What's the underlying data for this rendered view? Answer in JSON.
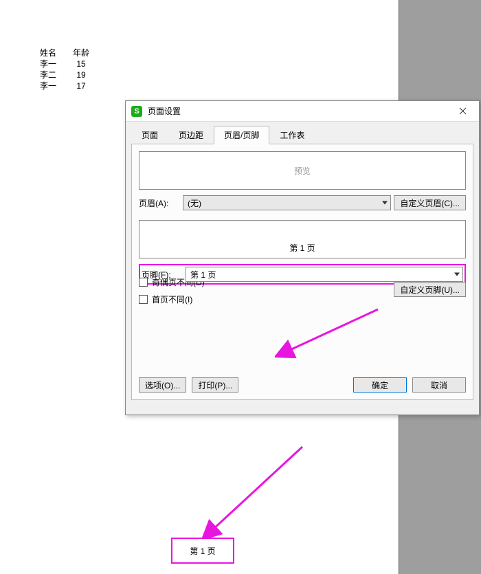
{
  "table": {
    "headers": [
      "姓名",
      "年龄"
    ],
    "rows": [
      [
        "李一",
        "15"
      ],
      [
        "李二",
        "19"
      ],
      [
        "李一",
        "17"
      ]
    ]
  },
  "dialog": {
    "title": "页面设置",
    "app_icon_letter": "S",
    "tabs": [
      "页面",
      "页边距",
      "页眉/页脚",
      "工作表"
    ],
    "preview_label": "预览",
    "header_label": "页眉(A):",
    "header_value": "(无)",
    "custom_header_btn": "自定义页眉(C)...",
    "footer_preview_text": "第 1 页",
    "footer_label": "页脚(F):",
    "footer_value": "第 1 页",
    "custom_footer_btn": "自定义页脚(U)...",
    "checkbox1": "奇偶页不同(D)",
    "checkbox2": "首页不同(I)",
    "options_btn": "选项(O)...",
    "print_btn": "打印(P)...",
    "ok_btn": "确定",
    "cancel_btn": "取消"
  },
  "page_footer": "第 1 页"
}
